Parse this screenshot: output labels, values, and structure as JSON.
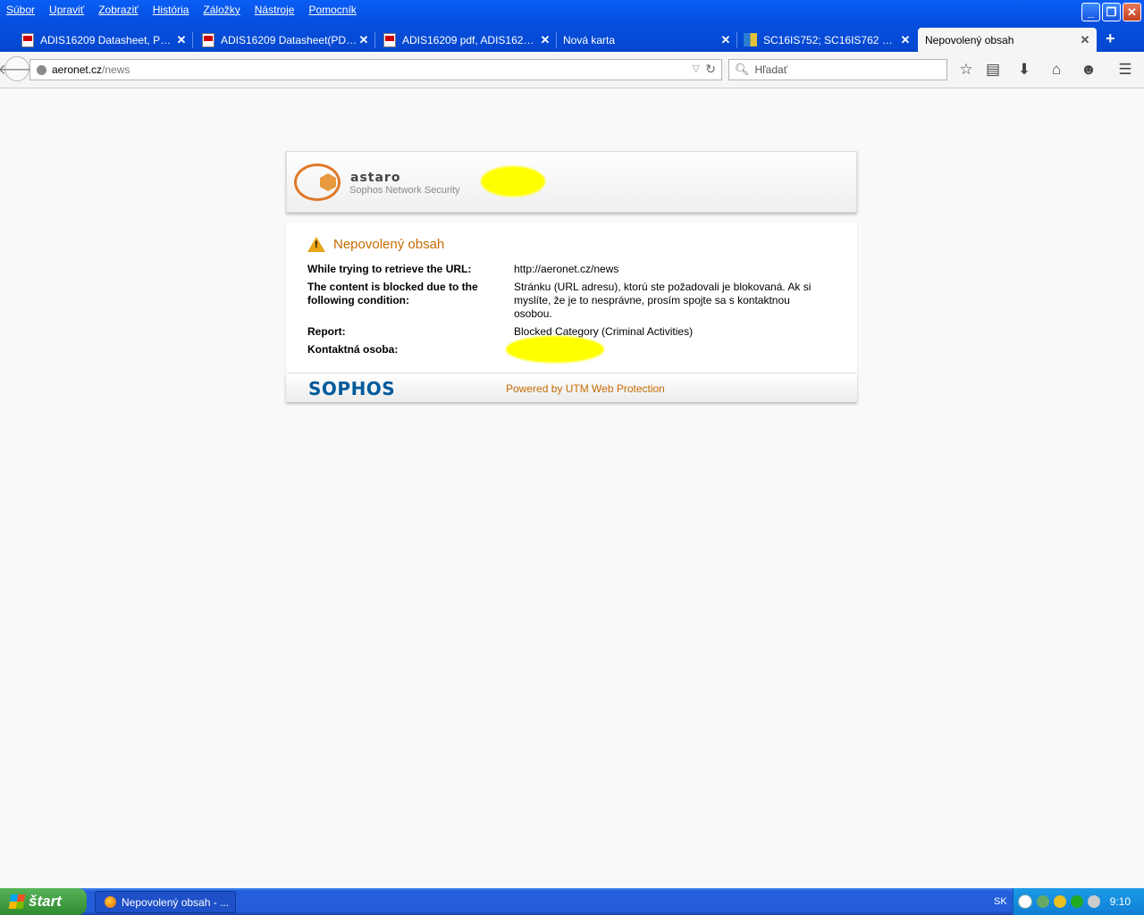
{
  "menu": [
    "Súbor",
    "Upraviť",
    "Zobraziť",
    "História",
    "Záložky",
    "Nástroje",
    "Pomocník"
  ],
  "tabs": [
    {
      "label": "ADIS16209 Datasheet, PDF...",
      "icon": "pdf-icon"
    },
    {
      "label": "ADIS16209 Datasheet(PDF)...",
      "icon": "pdf-icon"
    },
    {
      "label": "ADIS16209 pdf, ADIS16209...",
      "icon": "pdf-icon"
    },
    {
      "label": "Nová karta",
      "icon": ""
    },
    {
      "label": "SC16IS752; SC16IS762 Dua...",
      "icon": "image-icon"
    },
    {
      "label": "Nepovolený obsah",
      "icon": "",
      "active": true
    }
  ],
  "newtab_symbol": "+",
  "close_symbol": "✕",
  "url": {
    "host": "aeronet.cz",
    "path": "/news"
  },
  "search": {
    "placeholder": "Hľadať"
  },
  "header": {
    "brand": "astaro",
    "subtitle": "Sophos Network Security"
  },
  "block_page": {
    "title": "Nepovolený obsah",
    "rows": [
      {
        "label": "While trying to retrieve the URL:",
        "value": "http://aeronet.cz/news"
      },
      {
        "label": "The content is blocked due to the following condition:",
        "value": "Stránku (URL adresu), ktorú ste požadovali je blokovaná. Ak si myslíte, že je to nesprávne, prosím spojte sa s kontaktnou osobou."
      },
      {
        "label": "Report:",
        "value": "Blocked Category (Criminal Activities)"
      },
      {
        "label": "Kontaktná osoba:",
        "value": ""
      }
    ],
    "footer_logo": "SOPHOS",
    "powered_by": "Powered by UTM Web Protection"
  },
  "taskbar": {
    "start_label": "štart",
    "task_label": "Nepovolený obsah - ...",
    "language": "SK",
    "clock": "9:10"
  },
  "colors": {
    "accent": "#c76b00",
    "xp_blue": "#245edb",
    "sophos_blue": "#005a9c",
    "redaction": "#ffff00"
  }
}
